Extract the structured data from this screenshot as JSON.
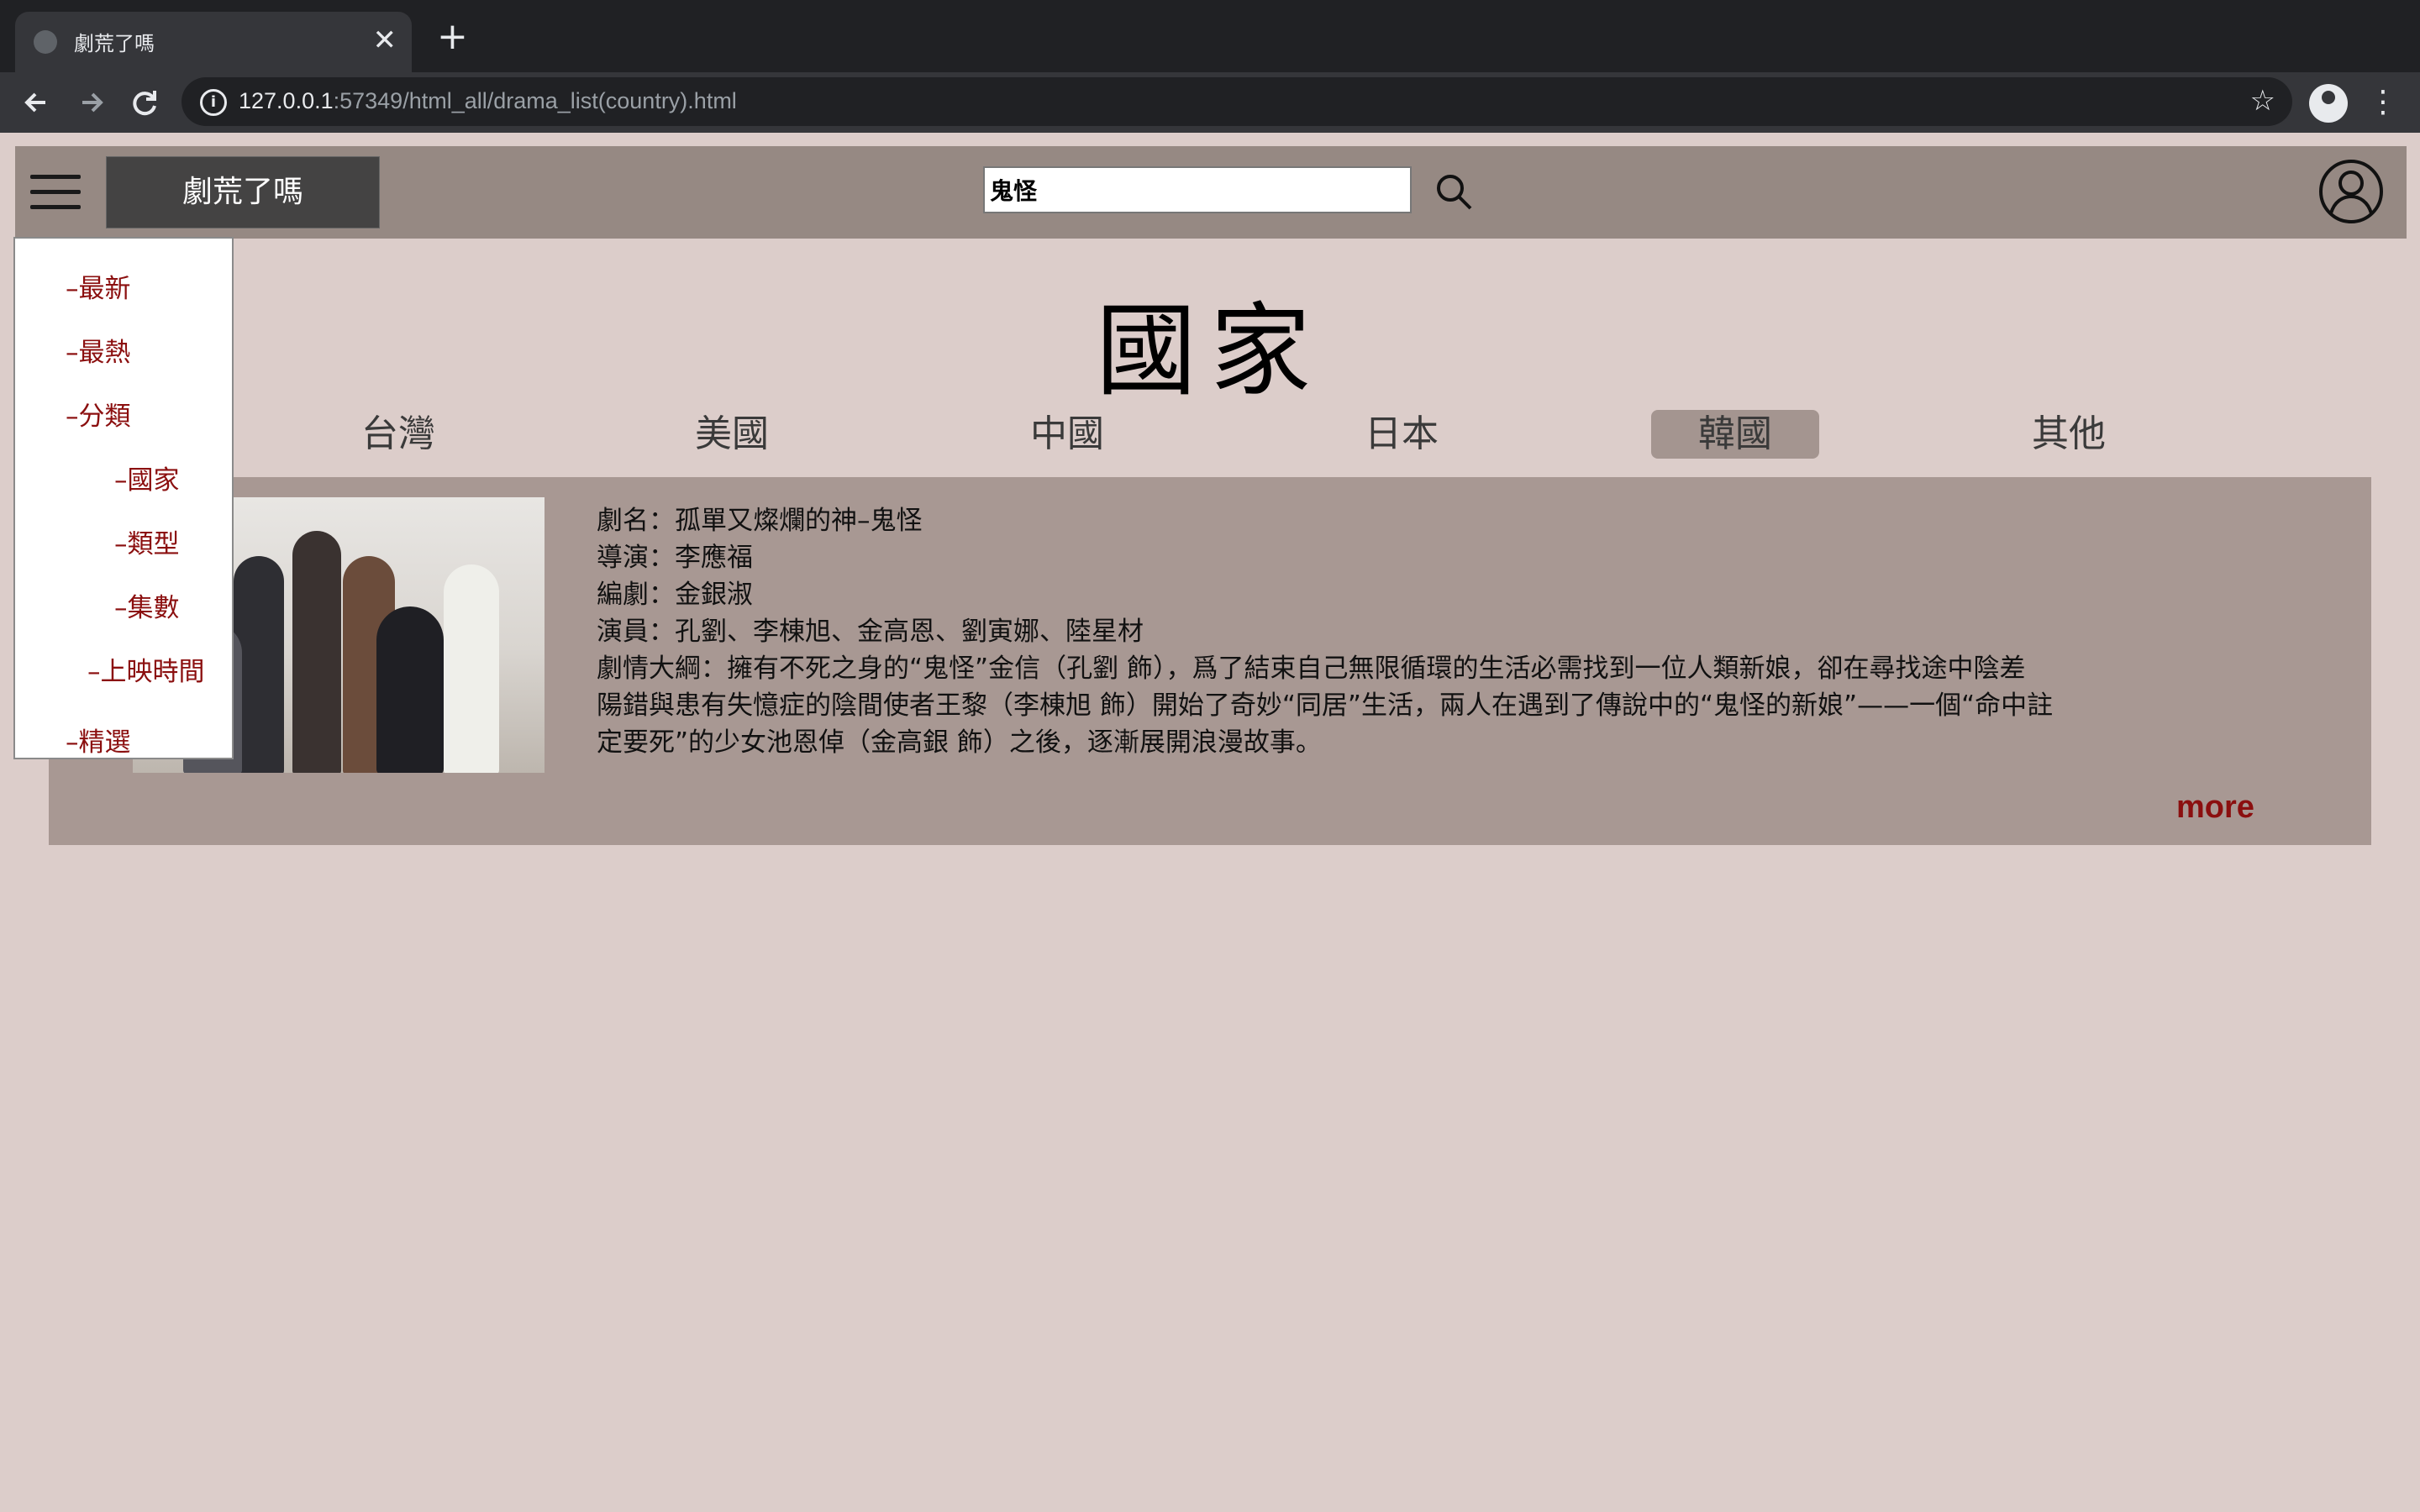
{
  "browser": {
    "tab_title": "劇荒了嗎",
    "close_glyph": "✕",
    "newtab_glyph": "+",
    "url_host": "127.0.0.1",
    "url_rest": ":57349/html_all/drama_list(country).html",
    "icons": [
      "globe-icon",
      "back-icon",
      "forward-icon",
      "reload-icon",
      "info-icon",
      "star-icon",
      "profile-icon",
      "menu-dots-icon"
    ]
  },
  "header": {
    "logo": "劇荒了嗎",
    "search_value": "鬼怪"
  },
  "page": {
    "title": "國家"
  },
  "countries": [
    "台灣",
    "美國",
    "中國",
    "日本",
    "韓國",
    "其他"
  ],
  "active_country": "韓國",
  "drama": {
    "name": "劇名：孤單又燦爛的神–鬼怪",
    "director": "導演：李應福",
    "writer": "編劇：金銀淑",
    "cast": "演員：孔劉、李棟旭、金高恩、劉寅娜、陸星材",
    "synopsis_1": "劇情大綱：擁有不死之身的“鬼怪”金信（孔劉 飾），爲了結束自己無限循環的生活必需找到一位人類新娘，卻在尋找途中陰差",
    "synopsis_2": "陽錯與患有失憶症的陰間使者王黎（李棟旭 飾）開始了奇妙“同居”生活，兩人在遇到了傳說中的“鬼怪的新娘”——一個“命中註",
    "synopsis_3": "定要死”的少女池恩倬（金高銀 飾）之後，逐漸展開浪漫故事。",
    "more": "more"
  },
  "menu": {
    "latest": "–最新",
    "hottest": "–最熱",
    "category": "–分類",
    "country": "–國家",
    "genre": "–類型",
    "episodes": "–集數",
    "airtime": "–上映時間",
    "featured": "–精選"
  },
  "colors": {
    "page_bg": "#dccdca",
    "header_bg": "#968983",
    "card_bg": "#a89893",
    "active_tab_bg": "#a49590",
    "link_red": "#8b0f0f"
  }
}
